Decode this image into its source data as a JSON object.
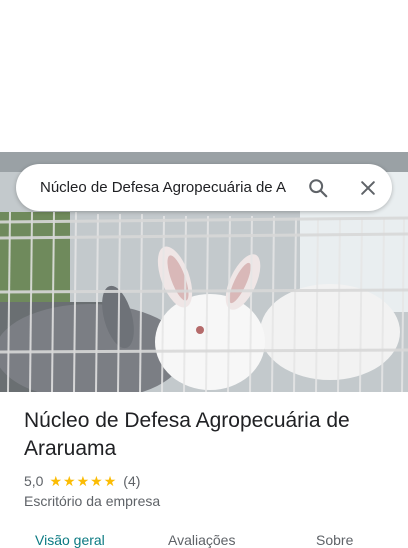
{
  "search": {
    "query": "Núcleo de Defesa Agropecuária de A"
  },
  "place": {
    "name": "Núcleo de Defesa Agropecuária de Araruama",
    "rating": "5,0",
    "stars": 5,
    "review_count": "(4)",
    "category": "Escritório da empresa"
  },
  "tabs": [
    "Visão geral",
    "Avaliações",
    "Sobre"
  ],
  "colors": {
    "accent": "#0b7a82",
    "star": "#fbbc04"
  }
}
